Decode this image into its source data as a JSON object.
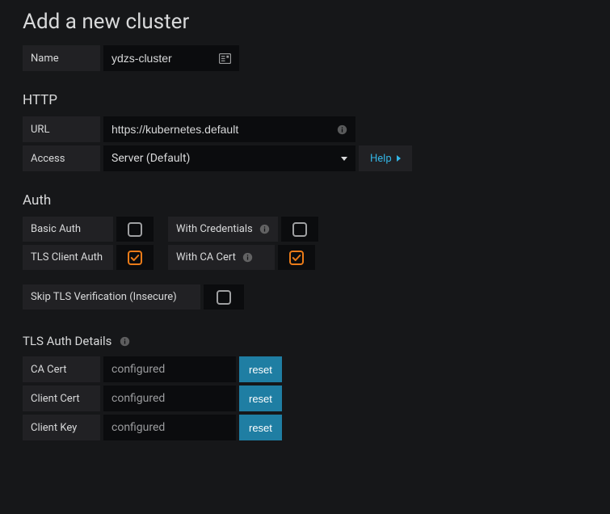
{
  "title": "Add a new cluster",
  "name": {
    "label": "Name",
    "value": "ydzs-cluster"
  },
  "http": {
    "heading": "HTTP",
    "url": {
      "label": "URL",
      "value": "https://kubernetes.default"
    },
    "access": {
      "label": "Access",
      "value": "Server (Default)"
    },
    "help": "Help"
  },
  "auth": {
    "heading": "Auth",
    "basic": {
      "label": "Basic Auth",
      "checked": false
    },
    "withCredentials": {
      "label": "With Credentials",
      "checked": false
    },
    "tlsClientAuth": {
      "label": "TLS Client Auth",
      "checked": true
    },
    "withCaCert": {
      "label": "With CA Cert",
      "checked": true
    },
    "skipTls": {
      "label": "Skip TLS Verification (Insecure)",
      "checked": false
    }
  },
  "tlsDetails": {
    "heading": "TLS Auth Details",
    "caCert": {
      "label": "CA Cert",
      "value": "configured",
      "reset": "reset"
    },
    "clientCert": {
      "label": "Client Cert",
      "value": "configured",
      "reset": "reset"
    },
    "clientKey": {
      "label": "Client Key",
      "value": "configured",
      "reset": "reset"
    }
  }
}
